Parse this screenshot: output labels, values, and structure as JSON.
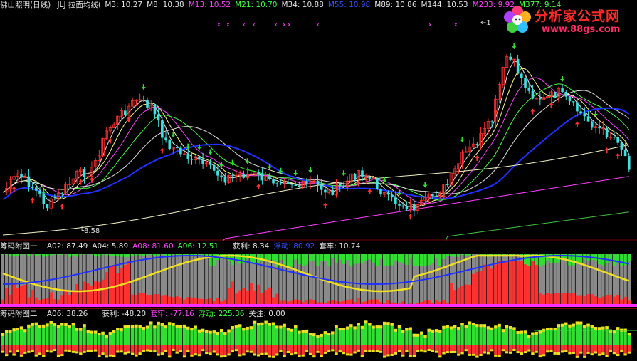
{
  "main": {
    "title": "佛山照明(日线)",
    "indicator": "JLJ 拉面均线(",
    "ma": [
      {
        "label": "M3: 10.27",
        "color": "#e0e0e0"
      },
      {
        "label": "M8: 10.38",
        "color": "#e0e0e0"
      },
      {
        "label": "M13: 10.52",
        "color": "#ff40ff"
      },
      {
        "label": "M21: 10.70",
        "color": "#40ff40"
      },
      {
        "label": "M34: 10.88",
        "color": "#e0e0e0"
      },
      {
        "label": "M55: 10.98",
        "color": "#3050ff"
      },
      {
        "label": "M89: 10.86",
        "color": "#e0e0e0"
      },
      {
        "label": "M144: 10.53",
        "color": "#e0e0e0"
      },
      {
        "label": "M233: 9.92",
        "color": "#ff40ff"
      },
      {
        "label": "M377: 9.14",
        "color": "#40ff40"
      }
    ],
    "low_marker": "8.58",
    "high_marker": "1"
  },
  "sub1": {
    "title": "筹码附图一",
    "items": [
      {
        "label": "A02: 87.49",
        "color": "#e0e0e0"
      },
      {
        "label": "A04: 5.89",
        "color": "#e0e0e0"
      },
      {
        "label": "A08: 81.60",
        "color": "#ff40ff"
      },
      {
        "label": "A06: 12.51",
        "color": "#40ff40"
      },
      {
        "label": "获利: 8.34",
        "color": "#e0e0e0"
      },
      {
        "label": "浮动: 80.92",
        "color": "#3050ff"
      },
      {
        "label": "套牢: 10.74",
        "color": "#e0e0e0"
      }
    ]
  },
  "sub2": {
    "title": "筹码附图二",
    "items": [
      {
        "label": "A06: 38.26",
        "color": "#e0e0e0"
      },
      {
        "label": "获利: -48.20",
        "color": "#e0e0e0"
      },
      {
        "label": "套牢: -77.16",
        "color": "#ff40ff"
      },
      {
        "label": "浮动: 225.36",
        "color": "#40ff40"
      },
      {
        "label": "关注: 0.00",
        "color": "#e0e0e0"
      }
    ]
  },
  "logo": {
    "title": "分析家公式网",
    "url": "www.88gs.com"
  },
  "colors": {
    "up": "#ff3030",
    "down": "#40e0e0",
    "ma55": "#2030ff",
    "yellow": "#f0e020",
    "green": "#30e030",
    "gray": "#8a8a8a",
    "magenta": "#ff30ff"
  }
}
